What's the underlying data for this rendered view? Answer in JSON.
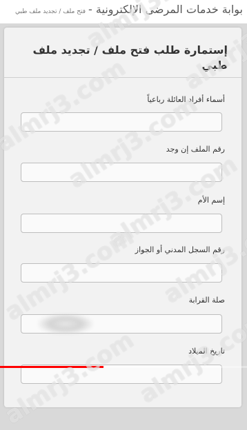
{
  "header": {
    "title": "بوابة خدمات المرضى الإلكترونية -",
    "breadcrumb": "فتح ملف / تجديد ملف طبي"
  },
  "form": {
    "title": "إستمارة طلب فتح ملف / تجديد ملف طبي",
    "fields": [
      {
        "label": "أسماء أفراد العائلة رباعياً",
        "value": ""
      },
      {
        "label": "رقم الملف إن وجد",
        "value": ""
      },
      {
        "label": "إسم الأم",
        "value": ""
      },
      {
        "label": "رقم السجل المدني أو الجواز",
        "value": ""
      },
      {
        "label": "صلة القرابة",
        "value": ""
      },
      {
        "label": "تاريخ الميلاد",
        "value": ""
      }
    ]
  },
  "video_progress": 0.42,
  "watermark": "almrj3.com",
  "colors": {
    "progress": "#ff0000"
  }
}
